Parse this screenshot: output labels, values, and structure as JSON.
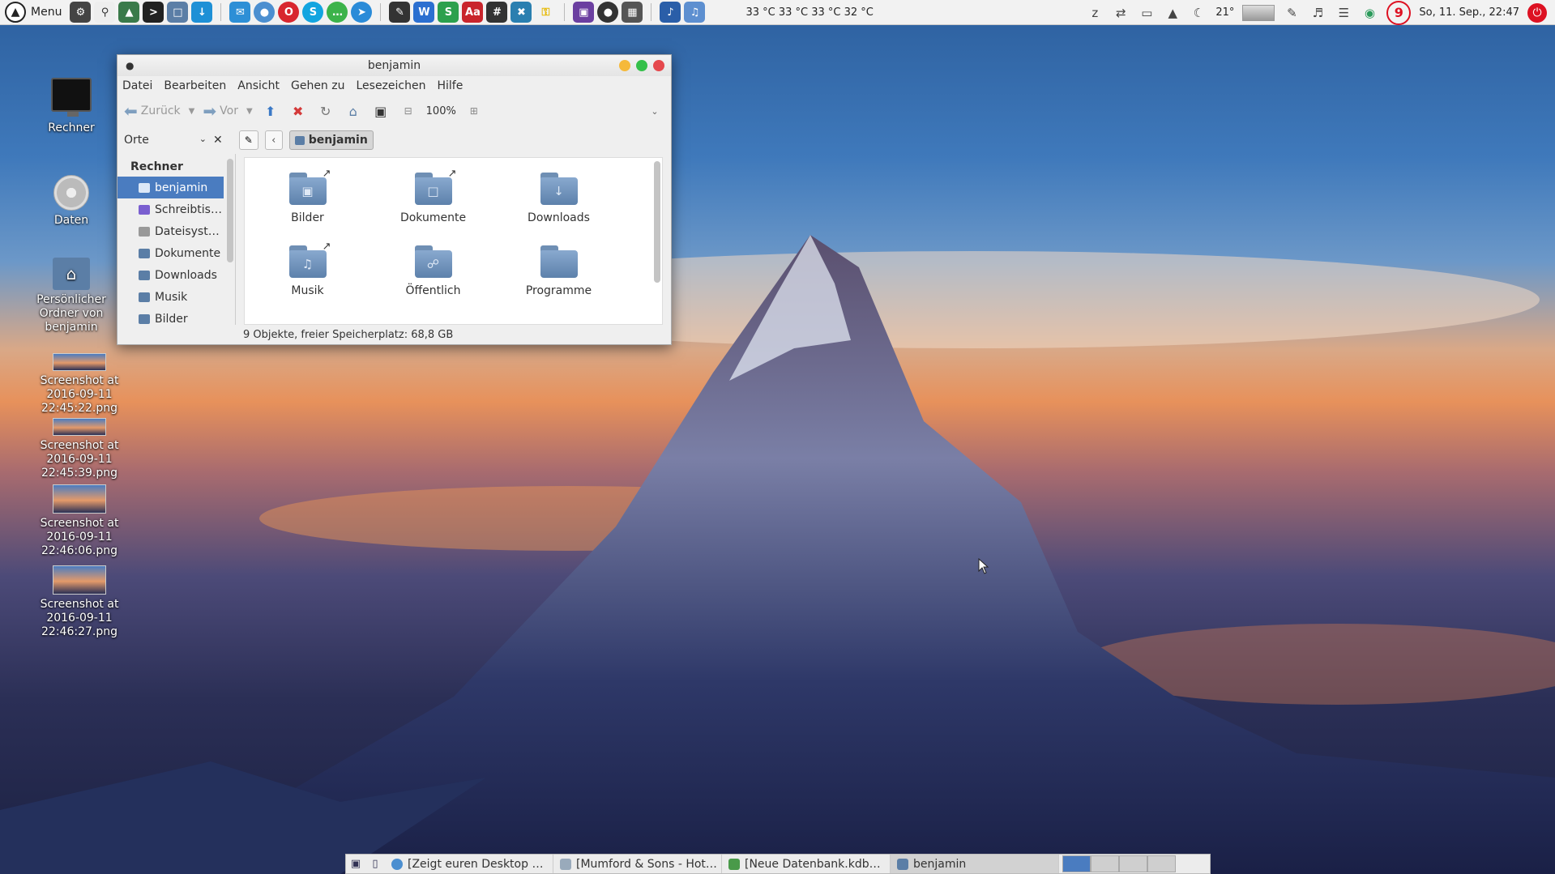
{
  "panel": {
    "menu_label": "Menu",
    "temperatures": "33 °C 33 °C 33 °C 32 °C",
    "weather": "21°",
    "notification_count": "9",
    "clock": "So, 11. Sep., 22:47"
  },
  "desktop": {
    "icons": [
      {
        "label": "Rechner"
      },
      {
        "label": "Daten"
      },
      {
        "label": "Persönlicher Ordner von benjamin"
      },
      {
        "label": "Screenshot at 2016-09-11 22:45:22.png"
      },
      {
        "label": "Screenshot at 2016-09-11 22:45:39.png"
      },
      {
        "label": "Screenshot at 2016-09-11 22:46:06.png"
      },
      {
        "label": "Screenshot at 2016-09-11 22:46:27.png"
      }
    ]
  },
  "window": {
    "title": "benjamin",
    "menu": [
      "Datei",
      "Bearbeiten",
      "Ansicht",
      "Gehen zu",
      "Lesezeichen",
      "Hilfe"
    ],
    "toolbar": {
      "back": "Zurück",
      "forward": "Vor",
      "zoom": "100%"
    },
    "places_label": "Orte",
    "breadcrumb": "benjamin",
    "sidebar": {
      "heading": "Rechner",
      "items": [
        "benjamin",
        "Schreibtis…",
        "Dateisyst…",
        "Dokumente",
        "Downloads",
        "Musik",
        "Bilder"
      ]
    },
    "files": [
      "Bilder",
      "Dokumente",
      "Downloads",
      "Musik",
      "Öffentlich",
      "Programme"
    ],
    "status": "9 Objekte, freier Speicherplatz: 68,8 GB"
  },
  "taskbar": {
    "items": [
      "[Zeigt euren Desktop …",
      "[Mumford & Sons - Hot…",
      "[Neue Datenbank.kdb…",
      "benjamin"
    ]
  },
  "colors": {
    "accent": "#4a7cc0",
    "notify": "#dd1122"
  }
}
